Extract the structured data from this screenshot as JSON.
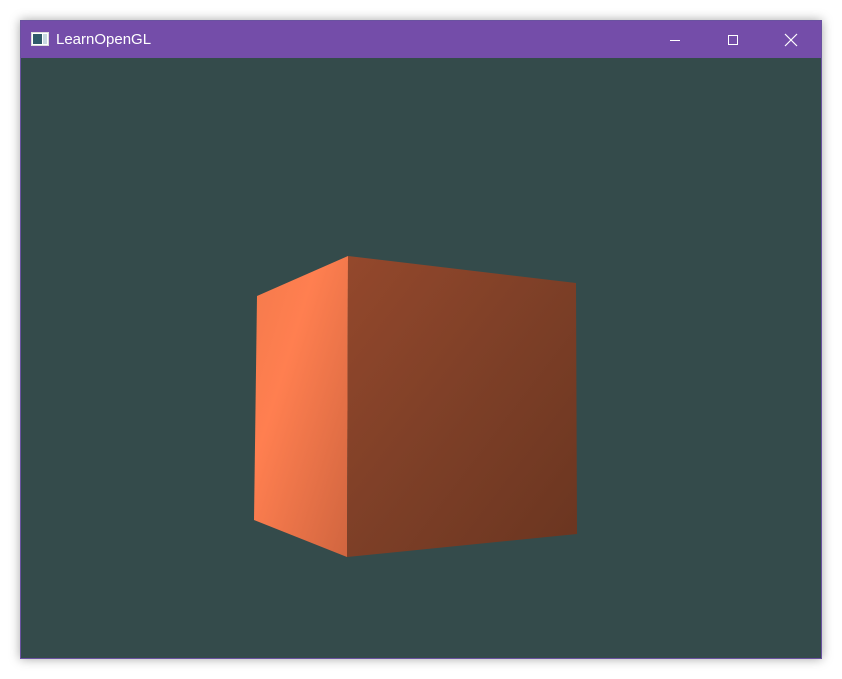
{
  "window": {
    "title": "LearnOpenGL"
  },
  "titlebar": {
    "color": "#744da9",
    "controls": [
      {
        "name": "minimize",
        "icon": "minimize-icon"
      },
      {
        "name": "maximize",
        "icon": "maximize-icon"
      },
      {
        "name": "close",
        "icon": "close-icon"
      }
    ]
  },
  "scene": {
    "clear_color": "#344b4b",
    "object": "cube",
    "object_color": "#ff7f50",
    "lighting": "diffuse"
  }
}
